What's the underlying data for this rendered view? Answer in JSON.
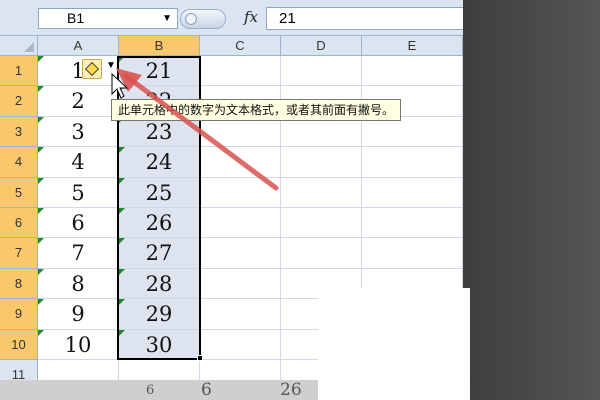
{
  "formula_bar": {
    "name_box": "B1",
    "name_box_arrow": "▼",
    "fx_label": "fx",
    "formula_value": "21"
  },
  "columns": [
    "A",
    "B",
    "C",
    "D",
    "E"
  ],
  "rows": [
    {
      "num": "1",
      "a": "1",
      "b": "21"
    },
    {
      "num": "2",
      "a": "2",
      "b": "22"
    },
    {
      "num": "3",
      "a": "3",
      "b": "23"
    },
    {
      "num": "4",
      "a": "4",
      "b": "24"
    },
    {
      "num": "5",
      "a": "5",
      "b": "25"
    },
    {
      "num": "6",
      "a": "6",
      "b": "26"
    },
    {
      "num": "7",
      "a": "7",
      "b": "27"
    },
    {
      "num": "8",
      "a": "8",
      "b": "28"
    },
    {
      "num": "9",
      "a": "9",
      "b": "29"
    },
    {
      "num": "10",
      "a": "10",
      "b": "30"
    },
    {
      "num": "11",
      "a": "",
      "b": ""
    }
  ],
  "warning": {
    "icon": "warning-diamond-icon",
    "tooltip": "此单元格中的数字为文本格式，或者其前面有撇号。"
  },
  "backdrop_text": [
    "6",
    "6",
    "26"
  ],
  "colors": {
    "header_bg": "#dbe5f1",
    "active_header": "#f8c86a",
    "selection_fill": "#dde3ef",
    "error_triangle": "#1c8a2e",
    "annotation_arrow": "#d9534f"
  }
}
